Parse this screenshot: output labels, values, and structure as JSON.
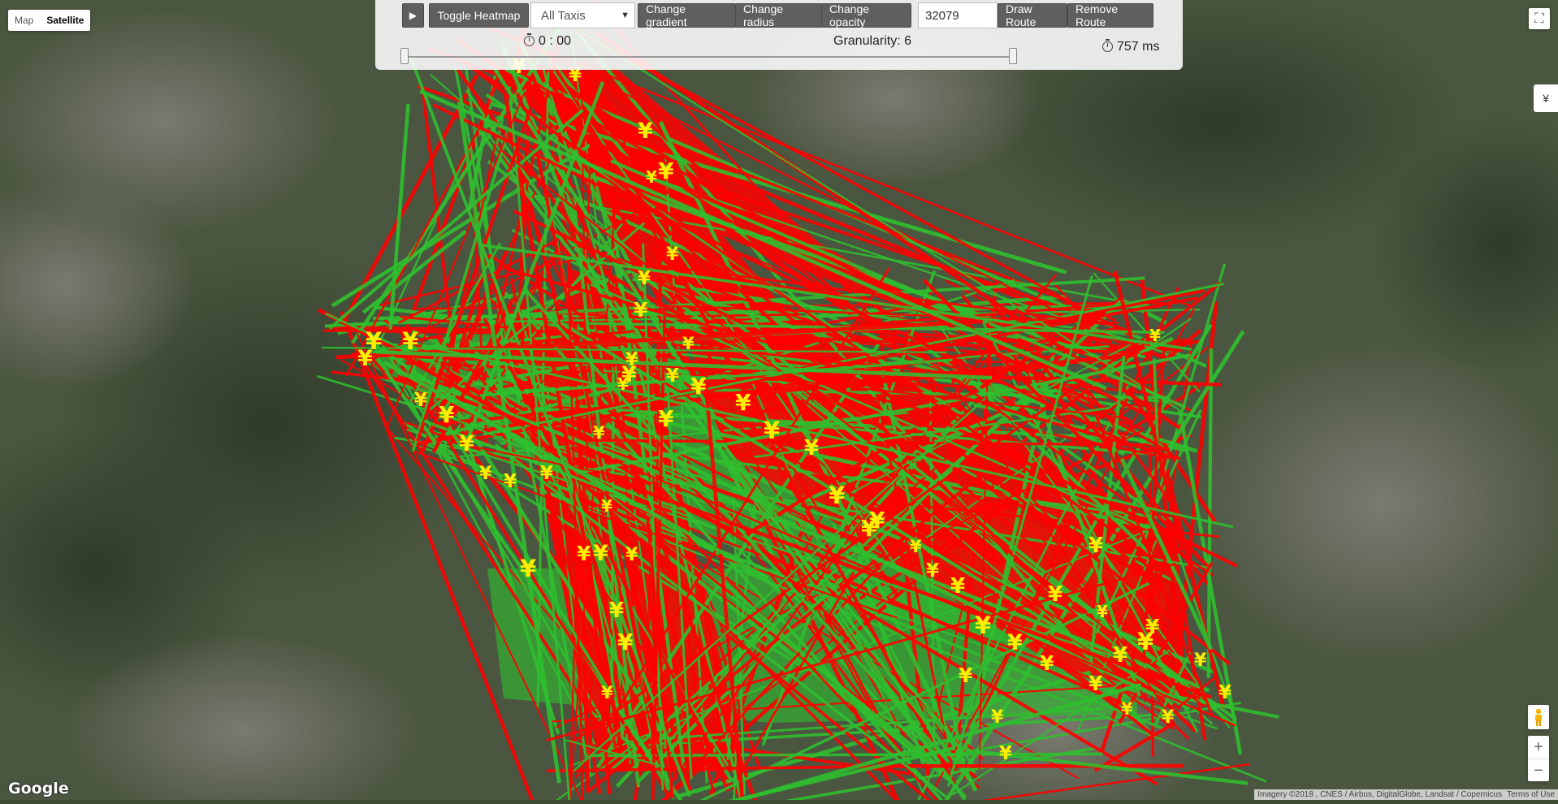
{
  "map_type": {
    "map": "Map",
    "satellite": "Satellite",
    "active": "Satellite"
  },
  "toolbar": {
    "play_icon": "▶",
    "toggle_heatmap": "Toggle Heatmap",
    "taxi_filter": "All Taxis",
    "change_gradient": "Change gradient",
    "change_radius": "Change radius",
    "change_opacity": "Change opacity",
    "route_id_value": "32079",
    "draw_route": "Draw Route",
    "remove_route": "Remove Route"
  },
  "status": {
    "time": "0 : 00",
    "granularity": "Granularity: 6",
    "duration": "757 ms"
  },
  "side_tab": "¥",
  "zoom": {
    "in": "+",
    "out": "−"
  },
  "logo": "Google",
  "attribution": {
    "imagery": "Imagery ©2018 , CNES / Airbus, DigitalGlobe, Landsat / Copernicus",
    "terms": "Terms of Use"
  },
  "colors": {
    "route_red": "#ff0000",
    "route_green": "#2fbf2f",
    "marker_yellow": "#ffee00"
  },
  "icons": [
    "play-icon",
    "clock-icon",
    "fullscreen-icon",
    "pegman-icon",
    "yen-marker-icon"
  ]
}
